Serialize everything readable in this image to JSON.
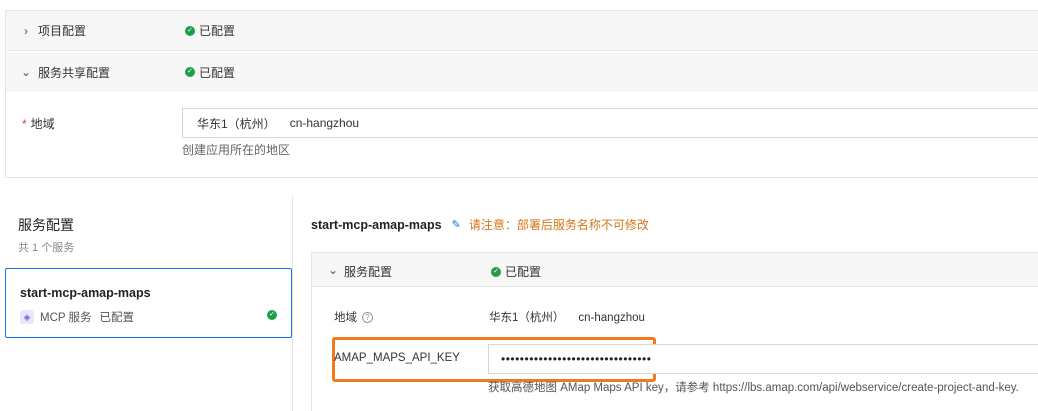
{
  "top_panel": {
    "project_config": {
      "title": "项目配置",
      "status": "已配置",
      "chevron": "chevron-right-icon"
    },
    "shared_config": {
      "title": "服务共享配置",
      "status": "已配置",
      "chevron": "chevron-down-icon"
    },
    "region": {
      "required_mark": "*",
      "label": "地域",
      "value_name": "华东1（杭州）",
      "value_code": "cn-hangzhou",
      "help": "创建应用所在的地区"
    }
  },
  "services": {
    "title": "服务配置",
    "count": "共 1 个服务",
    "items": [
      {
        "name": "start-mcp-amap-maps",
        "kind": "MCP 服务",
        "status": "已配置",
        "icon": "mcp-icon"
      }
    ]
  },
  "detail": {
    "name": "start-mcp-amap-maps",
    "warning": "请注意：部署后服务名称不可修改",
    "section": {
      "title": "服务配置",
      "status": "已配置"
    },
    "region": {
      "label": "地域",
      "value_name": "华东1（杭州）",
      "value_code": "cn-hangzhou"
    },
    "api_key": {
      "label": "AMAP_MAPS_API_KEY",
      "value": "••••••••••••••••••••••••••••••••",
      "help": "获取高德地图 AMap Maps API key，请参考 https://lbs.amap.com/api/webservice/create-project-and-key."
    }
  },
  "colors": {
    "accent": "#1b6fe0",
    "success": "#1f9e4a",
    "warning": "#d4761a",
    "highlight": "#f07a1d",
    "required": "#e03c2c"
  }
}
